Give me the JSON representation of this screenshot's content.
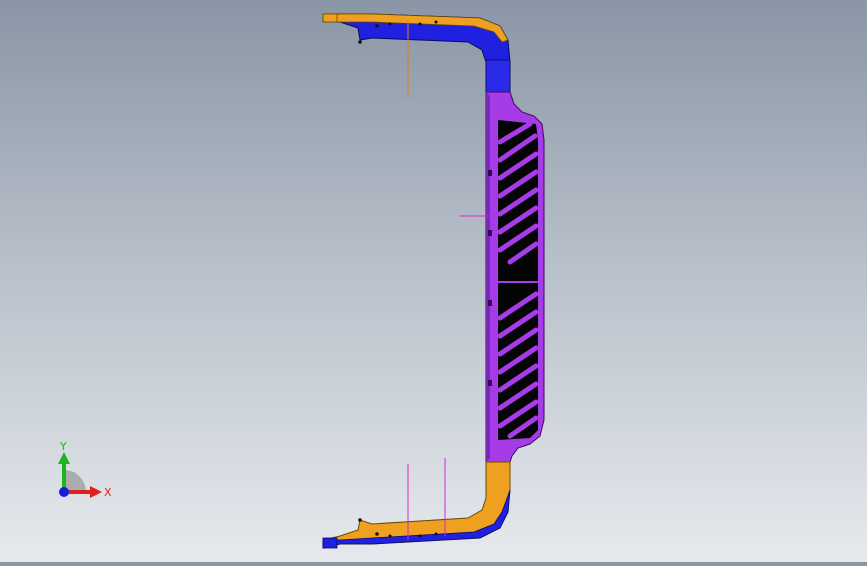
{
  "triad": {
    "x_label": "X",
    "y_label": "Y",
    "x_color": "#e0201c",
    "y_color": "#1fb41f",
    "z_color": "#1a1adc"
  },
  "model": {
    "colors": {
      "blue": "#2020e0",
      "orange": "#f0a020",
      "purple": "#a53ce8",
      "dark_purple": "#5a1a8a",
      "black": "#050505",
      "orange_ref_line": "#e07b1a",
      "magenta_ref_line": "#d02ad0"
    }
  },
  "viewport": {
    "background_top": "#8a96a6",
    "background_bottom": "#e6eaee"
  }
}
